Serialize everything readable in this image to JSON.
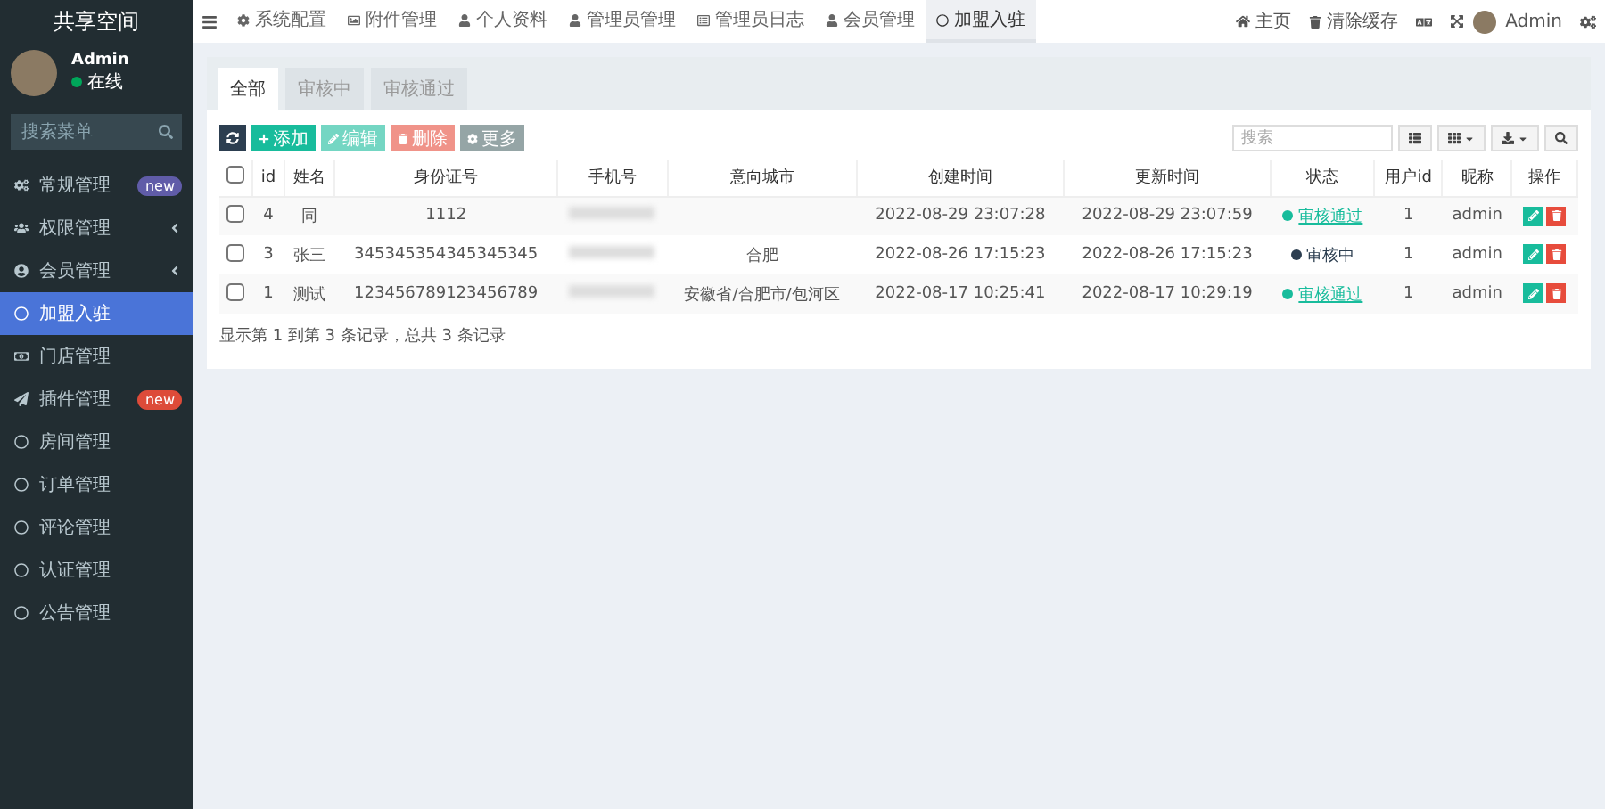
{
  "sidebar": {
    "title": "共享空间",
    "user": {
      "name": "Admin",
      "status": "在线"
    },
    "search": {
      "placeholder": "搜索菜单"
    },
    "items": [
      {
        "label": "常规管理",
        "selected": false,
        "expandable": false,
        "badge": "new",
        "color": "#605ca8"
      },
      {
        "label": "权限管理",
        "selected": false,
        "expandable": true
      },
      {
        "label": "会员管理",
        "selected": false,
        "expandable": true
      },
      {
        "label": "加盟入驻",
        "selected": true,
        "expandable": false
      },
      {
        "label": "门店管理",
        "selected": false,
        "expandable": false
      },
      {
        "label": "插件管理",
        "selected": false,
        "expandable": false,
        "badge": "new",
        "color": "#dd4b39"
      },
      {
        "label": "房间管理",
        "selected": false,
        "expandable": false
      },
      {
        "label": "订单管理",
        "selected": false,
        "expandable": false
      },
      {
        "label": "评论管理",
        "selected": false,
        "expandable": false
      },
      {
        "label": "认证管理",
        "selected": false,
        "expandable": false
      },
      {
        "label": "公告管理",
        "selected": false,
        "expandable": false
      }
    ]
  },
  "topbar": {
    "tabs": [
      {
        "label": "系统配置",
        "selected": false
      },
      {
        "label": "附件管理",
        "selected": false
      },
      {
        "label": "个人资料",
        "selected": false
      },
      {
        "label": "管理员管理",
        "selected": false
      },
      {
        "label": "管理员日志",
        "selected": false
      },
      {
        "label": "会员管理",
        "selected": false
      },
      {
        "label": "加盟入驻",
        "selected": true
      }
    ],
    "home": "主页",
    "clear_cache": "清除缓存",
    "user": "Admin"
  },
  "filter_tabs": [
    {
      "label": "全部",
      "selected": true
    },
    {
      "label": "审核中",
      "selected": false
    },
    {
      "label": "审核通过",
      "selected": false
    }
  ],
  "toolbar": {
    "buttons": [
      {
        "kind": "add",
        "label": "添加",
        "disabled": false
      },
      {
        "kind": "edit",
        "label": "编辑",
        "disabled": true
      },
      {
        "kind": "delete",
        "label": "删除",
        "disabled": true
      },
      {
        "kind": "more",
        "label": "更多",
        "disabled": false
      }
    ],
    "search": {
      "placeholder": "搜索"
    }
  },
  "table": {
    "columns": [
      "id",
      "姓名",
      "身份证号",
      "手机号",
      "意向城市",
      "创建时间",
      "更新时间",
      "状态",
      "用户id",
      "昵称",
      "操作"
    ],
    "header_checked": false,
    "rows": [
      {
        "checked": false,
        "id": "4",
        "name": "同",
        "id_card": "1112",
        "city": "",
        "created": "2022-08-29 23:07:28",
        "updated": "2022-08-29 23:07:59",
        "status": "审核通过",
        "kind": "approved",
        "user_id": "1",
        "nickname": "admin"
      },
      {
        "checked": false,
        "id": "3",
        "name": "张三",
        "id_card": "345345354345345345",
        "city": "合肥",
        "created": "2022-08-26 17:15:23",
        "updated": "2022-08-26 17:15:23",
        "status": "审核中",
        "kind": "pending",
        "user_id": "1",
        "nickname": "admin"
      },
      {
        "checked": false,
        "id": "1",
        "name": "测试",
        "id_card": "123456789123456789",
        "city": "安徽省/合肥市/包河区",
        "created": "2022-08-17 10:25:41",
        "updated": "2022-08-17 10:29:19",
        "status": "审核通过",
        "kind": "approved",
        "user_id": "1",
        "nickname": "admin"
      }
    ]
  },
  "pagination_info": "显示第 1 到第 3 条记录，总共 3 条记录"
}
